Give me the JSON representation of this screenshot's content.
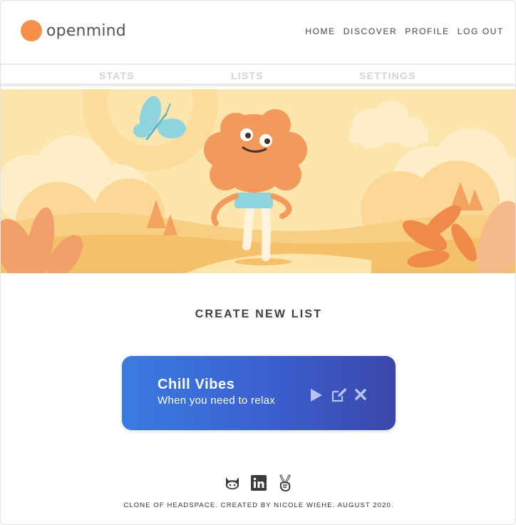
{
  "brand": {
    "name": "openmind",
    "color": "#f5914a"
  },
  "nav": {
    "items": [
      "HOME",
      "DISCOVER",
      "PROFILE",
      "LOG OUT"
    ]
  },
  "subnav": {
    "tabs": [
      "STATS",
      "LISTS",
      "SETTINGS"
    ]
  },
  "hero": {
    "illustration": "character-meditating-with-butterfly"
  },
  "create": {
    "label": "CREATE NEW LIST"
  },
  "list_card": {
    "title": "Chill Vibes",
    "subtitle": "When you need to relax",
    "actions": [
      "play-icon",
      "edit-icon",
      "delete-icon"
    ]
  },
  "footer": {
    "social": [
      "github-icon",
      "linkedin-icon",
      "peace-hand-icon"
    ],
    "text": "CLONE OF HEADSPACE. CREATED BY NICOLE WIEHE. AUGUST 2020."
  },
  "colors": {
    "accent": "#f5914a",
    "card_start": "#3a7be0",
    "card_end": "#3b47a8",
    "hero_bg": "#fde4a8"
  }
}
